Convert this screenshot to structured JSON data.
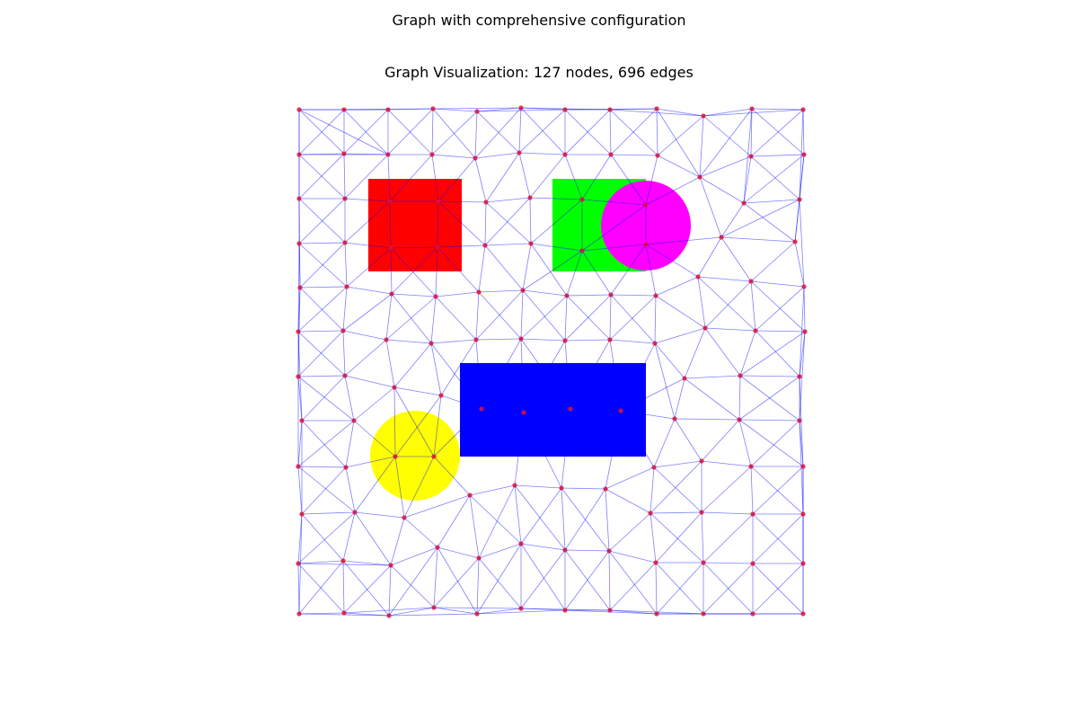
{
  "figure": {
    "suptitle": "Graph with comprehensive configuration",
    "title": "Graph Visualization: 127 nodes, 696 edges"
  },
  "style": {
    "background": "#ffffff",
    "edge_color": "#0000ff",
    "node_color": "#dc143c"
  },
  "obstacles": [
    {
      "name": "red-square",
      "shape": "rect",
      "color": "#ff0000"
    },
    {
      "name": "green-square",
      "shape": "rect",
      "color": "#00ff00"
    },
    {
      "name": "magenta-circle",
      "shape": "circle",
      "color": "#ff00ff"
    },
    {
      "name": "blue-rectangle",
      "shape": "rect",
      "color": "#0000ff"
    },
    {
      "name": "yellow-circle",
      "shape": "circle",
      "color": "#ffff00"
    }
  ]
}
